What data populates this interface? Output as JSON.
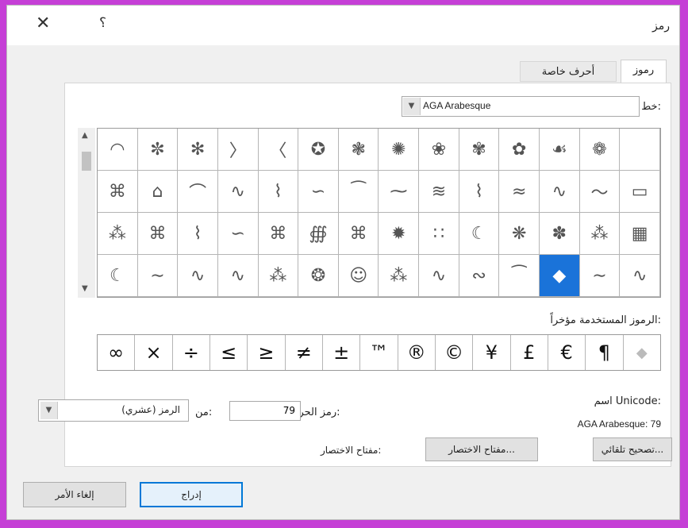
{
  "dialog": {
    "title": "رمز",
    "help_label": "؟",
    "close_label": "✕"
  },
  "tabs": [
    {
      "label": "رموز",
      "active": true
    },
    {
      "label": "أحرف خاصة",
      "active": false
    }
  ],
  "font": {
    "label": "خط:",
    "value": "AGA Arabesque"
  },
  "symbol_grid": {
    "rows": [
      [
        "",
        "❁",
        "☙",
        "✿",
        "✾",
        "❀",
        "✺",
        "❃",
        "✪",
        "〈",
        "〉",
        "✻",
        "✼",
        "◠"
      ],
      [
        "▭",
        "～",
        "∿",
        "≈",
        "⌇",
        "≋",
        "⁓",
        "⁀",
        "∽",
        "⌇",
        "∿",
        "⌒",
        "⌂",
        "⌘"
      ],
      [
        "▦",
        "⁂",
        "✽",
        "❋",
        "☾",
        "∷",
        "✹",
        "⌘",
        "∰",
        "⌘",
        "∽",
        "⌇",
        "⌘",
        "⁂"
      ],
      [
        "∿",
        "∼",
        "◆",
        "⁀",
        "∾",
        "∿",
        "⁂",
        "☺",
        "❂",
        "⁂",
        "∿",
        "∿",
        "∼",
        "☾"
      ]
    ],
    "selected_row": 3,
    "selected_col": 2
  },
  "recent": {
    "label": "الرموز المستخدمة مؤخراً:",
    "symbols": [
      "◆",
      "¶",
      "€",
      "£",
      "¥",
      "©",
      "®",
      "™",
      "±",
      "≠",
      "≥",
      "≤",
      "÷",
      "×",
      "∞"
    ]
  },
  "unicode": {
    "label": "اسم Unicode:",
    "value": "AGA Arabesque: 79"
  },
  "char_code": {
    "label": "رمز الحرف:",
    "value": "79"
  },
  "from": {
    "label": "من:",
    "value": "الرمز (عشري)"
  },
  "buttons": {
    "autocorrect": "تصحيح تلقائي...",
    "shortcut_key": "مفتاح الاختصار...",
    "shortcut_key_label": "مفتاح الاختصار:",
    "insert": "إدراج",
    "cancel": "إلغاء الأمر"
  }
}
